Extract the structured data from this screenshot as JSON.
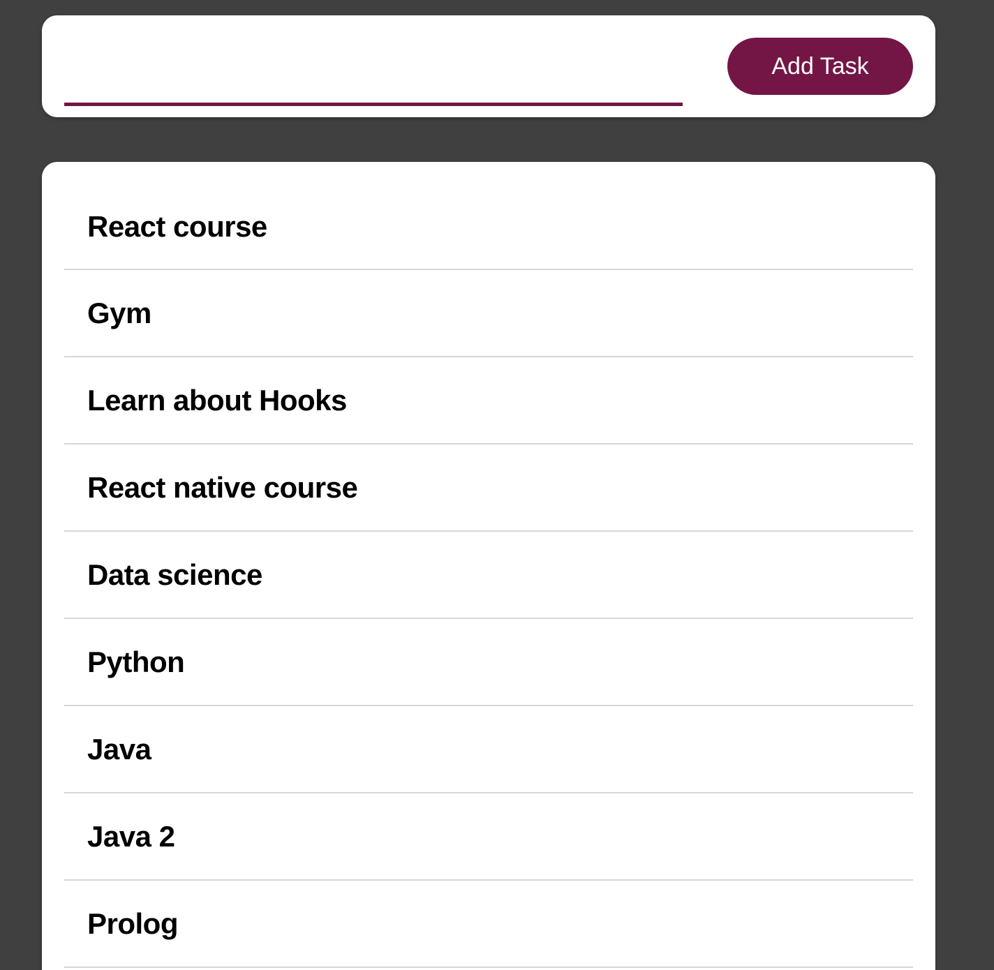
{
  "form": {
    "input_value": "",
    "input_placeholder": "",
    "add_button_label": "Add Task"
  },
  "tasks": [
    {
      "label": "React course"
    },
    {
      "label": "Gym"
    },
    {
      "label": "Learn about Hooks"
    },
    {
      "label": "React native course"
    },
    {
      "label": "Data science"
    },
    {
      "label": "Python"
    },
    {
      "label": "Java"
    },
    {
      "label": "Java 2"
    },
    {
      "label": "Prolog"
    }
  ],
  "colors": {
    "background": "#404040",
    "accent": "#741645",
    "card": "#ffffff",
    "divider": "#d6d6d6"
  }
}
